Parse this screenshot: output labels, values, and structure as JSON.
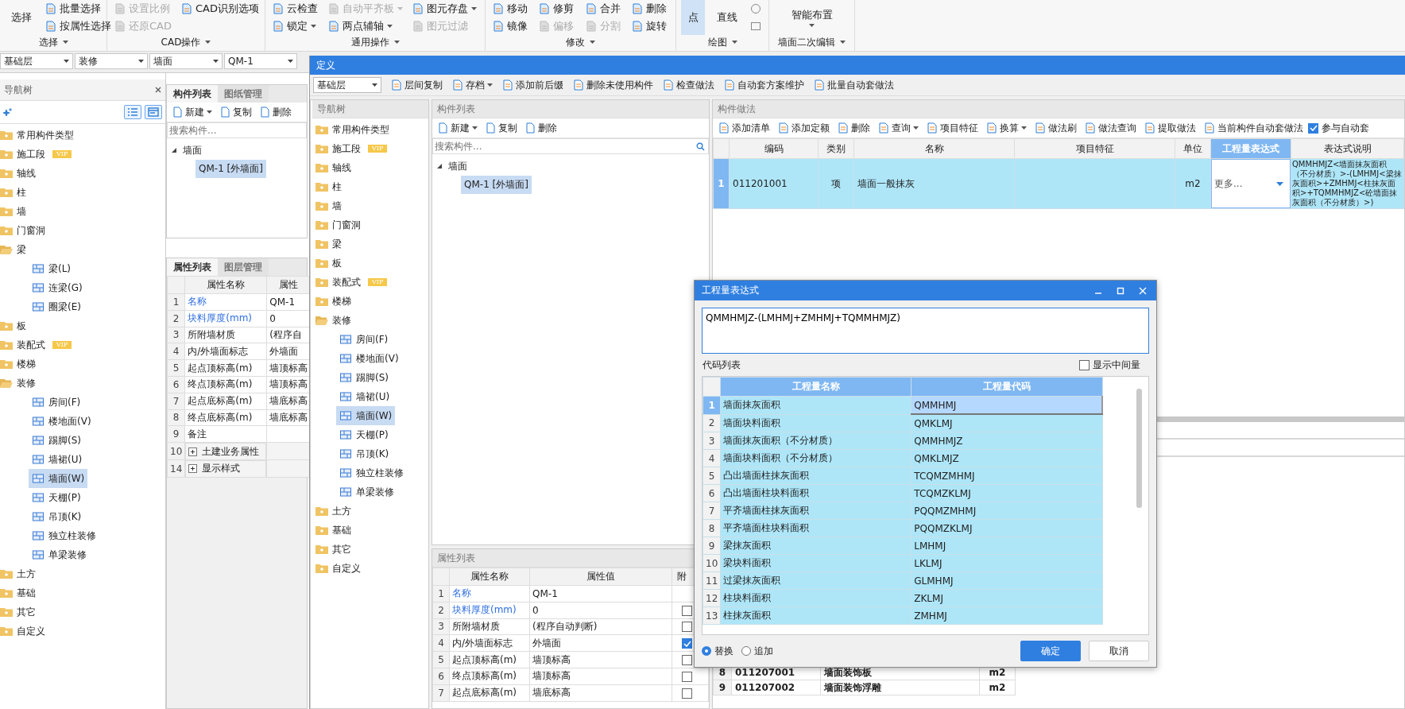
{
  "ribbon": {
    "groups": [
      {
        "label": "选择",
        "items": [
          {
            "kind": "large",
            "label": "选择",
            "dropdown": false,
            "disabled": false
          },
          {
            "kind": "small",
            "label": "批量选择",
            "dropdown": false,
            "disabled": false
          },
          {
            "kind": "small",
            "label": "按属性选择",
            "dropdown": false,
            "disabled": false
          }
        ]
      },
      {
        "label": "CAD操作",
        "items": [
          {
            "kind": "small",
            "label": "设置比例",
            "dropdown": false,
            "disabled": true
          },
          {
            "kind": "small",
            "label": "还原CAD",
            "dropdown": false,
            "disabled": true
          },
          {
            "kind": "small",
            "label": "CAD识别选项",
            "dropdown": false,
            "disabled": false
          }
        ]
      },
      {
        "label": "通用操作",
        "items": [
          {
            "kind": "small",
            "label": "云检查",
            "dropdown": false,
            "disabled": false
          },
          {
            "kind": "small",
            "label": "锁定",
            "dropdown": true,
            "disabled": false
          },
          {
            "kind": "small",
            "label": "自动平齐板",
            "dropdown": true,
            "disabled": true
          },
          {
            "kind": "small",
            "label": "两点辅轴",
            "dropdown": true,
            "disabled": false
          },
          {
            "kind": "small",
            "label": "图元存盘",
            "dropdown": true,
            "disabled": false
          },
          {
            "kind": "small",
            "label": "图元过滤",
            "dropdown": false,
            "disabled": true
          }
        ]
      },
      {
        "label": "修改",
        "items": [
          {
            "kind": "small",
            "label": "移动",
            "dropdown": false,
            "disabled": false
          },
          {
            "kind": "small",
            "label": "镜像",
            "dropdown": false,
            "disabled": false
          },
          {
            "kind": "small",
            "label": "修剪",
            "dropdown": false,
            "disabled": false
          },
          {
            "kind": "small",
            "label": "偏移",
            "dropdown": false,
            "disabled": true
          },
          {
            "kind": "small",
            "label": "合并",
            "dropdown": false,
            "disabled": false
          },
          {
            "kind": "small",
            "label": "分割",
            "dropdown": false,
            "disabled": true
          },
          {
            "kind": "small",
            "label": "删除",
            "dropdown": false,
            "disabled": false
          },
          {
            "kind": "small",
            "label": "旋转",
            "dropdown": false,
            "disabled": false
          }
        ]
      },
      {
        "label": "绘图",
        "items": [
          {
            "kind": "large",
            "label": "点",
            "selected": true,
            "dropdown": false,
            "disabled": false
          },
          {
            "kind": "large",
            "label": "直线",
            "selected": false,
            "dropdown": false,
            "disabled": false
          },
          {
            "kind": "circle",
            "selected": false
          },
          {
            "kind": "rect",
            "selected": false
          }
        ]
      },
      {
        "label": "墙面二次编辑",
        "items": [
          {
            "kind": "large",
            "label": "智能布置",
            "dropdown": true,
            "disabled": false
          }
        ]
      }
    ]
  },
  "selectors": [
    "基础层",
    "装修",
    "墙面",
    "QM-1"
  ],
  "nav_tree": {
    "title": "导航树",
    "items": [
      {
        "label": "常用构件类型",
        "expanded": false
      },
      {
        "label": "施工段",
        "badge": "VIP",
        "expanded": false
      },
      {
        "label": "轴线",
        "expanded": false
      },
      {
        "label": "柱",
        "expanded": false
      },
      {
        "label": "墙",
        "expanded": false
      },
      {
        "label": "门窗洞",
        "expanded": false
      },
      {
        "label": "梁",
        "expanded": true,
        "children": [
          {
            "label": "梁(L)",
            "selected": false
          },
          {
            "label": "连梁(G)",
            "selected": false
          },
          {
            "label": "圈梁(E)",
            "selected": false
          }
        ]
      },
      {
        "label": "板",
        "expanded": false
      },
      {
        "label": "装配式",
        "badge": "VIP",
        "expanded": false
      },
      {
        "label": "楼梯",
        "expanded": false
      },
      {
        "label": "装修",
        "expanded": true,
        "children": [
          {
            "label": "房间(F)",
            "selected": false
          },
          {
            "label": "楼地面(V)",
            "selected": false
          },
          {
            "label": "踢脚(S)",
            "selected": false
          },
          {
            "label": "墙裙(U)",
            "selected": false
          },
          {
            "label": "墙面(W)",
            "selected": true
          },
          {
            "label": "天棚(P)",
            "selected": false
          },
          {
            "label": "吊顶(K)",
            "selected": false
          },
          {
            "label": "独立柱装修",
            "selected": false
          },
          {
            "label": "单梁装修",
            "selected": false
          }
        ]
      },
      {
        "label": "土方",
        "expanded": false
      },
      {
        "label": "基础",
        "expanded": false
      },
      {
        "label": "其它",
        "expanded": false
      },
      {
        "label": "自定义",
        "expanded": false
      }
    ]
  },
  "component_panel": {
    "tabs": [
      {
        "label": "构件列表",
        "selected": true
      },
      {
        "label": "图纸管理",
        "selected": false
      }
    ],
    "toolbar": [
      {
        "label": "新建",
        "dropdown": true
      },
      {
        "label": "复制",
        "dropdown": false
      },
      {
        "label": "删除",
        "dropdown": false
      }
    ],
    "search": {
      "placeholder": "搜索构件..."
    },
    "tree": [
      {
        "label": "墙面",
        "expanded": true,
        "children": [
          {
            "label": "QM-1 [外墙面]",
            "selected": true
          }
        ]
      }
    ]
  },
  "property_panel": {
    "tabs": [
      {
        "label": "属性列表",
        "selected": true
      },
      {
        "label": "图层管理",
        "selected": false
      }
    ],
    "columns": [
      "属性名称",
      "属性"
    ],
    "rows": [
      {
        "num": "1",
        "name": "名称",
        "value": "QM-1",
        "emphasized": true,
        "kind": "field"
      },
      {
        "num": "2",
        "name": "块料厚度(mm)",
        "value": "0",
        "emphasized": true,
        "kind": "field"
      },
      {
        "num": "3",
        "name": "所附墙材质",
        "value": "(程序自",
        "emphasized": false,
        "kind": "field"
      },
      {
        "num": "4",
        "name": "内/外墙面标志",
        "value": "外墙面",
        "emphasized": false,
        "kind": "field"
      },
      {
        "num": "5",
        "name": "起点顶标高(m)",
        "value": "墙顶标高",
        "emphasized": false,
        "kind": "field"
      },
      {
        "num": "6",
        "name": "终点顶标高(m)",
        "value": "墙顶标高",
        "emphasized": false,
        "kind": "field"
      },
      {
        "num": "7",
        "name": "起点底标高(m)",
        "value": "墙底标高",
        "emphasized": false,
        "kind": "field"
      },
      {
        "num": "8",
        "name": "终点底标高(m)",
        "value": "墙底标高",
        "emphasized": false,
        "kind": "field"
      },
      {
        "num": "9",
        "name": "备注",
        "emphasized": false,
        "kind": "field"
      },
      {
        "num": "10",
        "name": "土建业务属性",
        "emphasized": false,
        "kind": "group"
      },
      {
        "num": "14",
        "name": "显示样式",
        "emphasized": false,
        "kind": "group"
      }
    ]
  },
  "definition": {
    "title": "定义",
    "floor": "基础层",
    "toolbar": [
      {
        "label": "层间复制",
        "dropdown": false
      },
      {
        "label": "存档",
        "dropdown": true
      },
      {
        "label": "添加前后缀",
        "dropdown": false
      },
      {
        "label": "删除未使用构件",
        "dropdown": false
      },
      {
        "label": "检查做法",
        "dropdown": false
      },
      {
        "label": "自动套方案维护",
        "dropdown": false
      },
      {
        "label": "批量自动套做法",
        "dropdown": false
      }
    ],
    "nav_tree": {
      "title": "导航树",
      "items": [
        {
          "label": "常用构件类型",
          "expanded": false
        },
        {
          "label": "施工段",
          "badge": "VIP",
          "expanded": false
        },
        {
          "label": "轴线",
          "expanded": false
        },
        {
          "label": "柱",
          "expanded": false
        },
        {
          "label": "墙",
          "expanded": false
        },
        {
          "label": "门窗洞",
          "expanded": false
        },
        {
          "label": "梁",
          "expanded": false
        },
        {
          "label": "板",
          "expanded": false
        },
        {
          "label": "装配式",
          "badge": "VIP",
          "expanded": false
        },
        {
          "label": "楼梯",
          "expanded": false
        },
        {
          "label": "装修",
          "expanded": true,
          "children": [
            {
              "label": "房间(F)",
              "selected": false
            },
            {
              "label": "楼地面(V)",
              "selected": false
            },
            {
              "label": "踢脚(S)",
              "selected": false
            },
            {
              "label": "墙裙(U)",
              "selected": false
            },
            {
              "label": "墙面(W)",
              "selected": true
            },
            {
              "label": "天棚(P)",
              "selected": false
            },
            {
              "label": "吊顶(K)",
              "selected": false
            },
            {
              "label": "独立柱装修",
              "selected": false
            },
            {
              "label": "单梁装修",
              "selected": false
            }
          ]
        },
        {
          "label": "土方",
          "expanded": false
        },
        {
          "label": "基础",
          "expanded": false
        },
        {
          "label": "其它",
          "expanded": false
        },
        {
          "label": "自定义",
          "expanded": false
        }
      ]
    },
    "component_list": {
      "title": "构件列表",
      "toolbar": [
        {
          "label": "新建",
          "dropdown": true
        },
        {
          "label": "复制",
          "dropdown": false
        },
        {
          "label": "删除",
          "dropdown": false
        }
      ],
      "search": {
        "placeholder": "搜索构件..."
      },
      "tree": [
        {
          "label": "墙面",
          "expanded": true,
          "children": [
            {
              "label": "QM-1 [外墙面]",
              "selected": true
            }
          ]
        }
      ]
    },
    "properties": {
      "title": "属性列表",
      "columns": [
        "属性名称",
        "属性值",
        "附"
      ],
      "rows": [
        {
          "num": "1",
          "name": "名称",
          "value": "QM-1",
          "emphasized": true
        },
        {
          "num": "2",
          "name": "块料厚度(mm)",
          "value": "0",
          "emphasized": true,
          "checked": false
        },
        {
          "num": "3",
          "name": "所附墙材质",
          "value": "(程序自动判断)",
          "emphasized": false,
          "checked": false
        },
        {
          "num": "4",
          "name": "内/外墙面标志",
          "value": "外墙面",
          "emphasized": false,
          "checked": true
        },
        {
          "num": "5",
          "name": "起点顶标高(m)",
          "value": "墙顶标高",
          "emphasized": false,
          "checked": false
        },
        {
          "num": "6",
          "name": "终点顶标高(m)",
          "value": "墙顶标高",
          "emphasized": false,
          "checked": false
        },
        {
          "num": "7",
          "name": "起点底标高(m)",
          "value": "墙底标高",
          "emphasized": false,
          "checked": false
        }
      ]
    },
    "method_panel": {
      "title": "构件做法",
      "toolbar": [
        {
          "label": "添加清单",
          "dropdown": false
        },
        {
          "label": "添加定额",
          "dropdown": false
        },
        {
          "label": "删除",
          "dropdown": false
        },
        {
          "label": "查询",
          "dropdown": true
        },
        {
          "label": "项目特征",
          "dropdown": false
        },
        {
          "label": "换算",
          "dropdown": true
        },
        {
          "label": "做法刷",
          "dropdown": false
        },
        {
          "label": "做法查询",
          "dropdown": false
        },
        {
          "label": "提取做法",
          "dropdown": false
        },
        {
          "label": "当前构件自动套做法",
          "dropdown": false
        }
      ],
      "auto_apply": {
        "label": "参与自动套",
        "checked": true
      },
      "columns": [
        {
          "label": "编码",
          "selected": false
        },
        {
          "label": "类别",
          "selected": false
        },
        {
          "label": "名称",
          "selected": false
        },
        {
          "label": "项目特征",
          "selected": false
        },
        {
          "label": "单位",
          "selected": false
        },
        {
          "label": "工程量表达式",
          "selected": true
        },
        {
          "label": "表达式说明",
          "selected": false
        }
      ],
      "rows": [
        {
          "num": "1",
          "code": "011201001",
          "type": "项",
          "name": "墙面一般抹灰",
          "unit": "m2",
          "expression": "更多...",
          "description": "QMMHMJZ<墙面抹灰面积（不分材质）>-(LMHMJ<梁抹灰面积>+ZMHMJ<柱抹灰面积>+TQMMHMJZ<砼墙面抹灰面积（不分材质）>)",
          "selected": true
        }
      ],
      "lower_rows": [
        {
          "num": "8",
          "code": "011207001",
          "name": "墙面装饰板",
          "unit": "m2"
        },
        {
          "num": "9",
          "code": "011207002",
          "name": "墙面装饰浮雕",
          "unit": "m2"
        }
      ]
    }
  },
  "dialog": {
    "title": "工程量表达式",
    "expression": "QMMHMJZ-(LMHMJ+ZMHMJ+TQMMHMJZ)",
    "list_label": "代码列表",
    "show_intermediate": {
      "label": "显示中间量",
      "checked": false
    },
    "columns": [
      "工程量名称",
      "工程量代码"
    ],
    "rows": [
      {
        "num": "1",
        "name": "墙面抹灰面积",
        "code": "QMMHMJ",
        "selected": true
      },
      {
        "num": "2",
        "name": "墙面块料面积",
        "code": "QMKLMJ",
        "selected": false
      },
      {
        "num": "3",
        "name": "墙面抹灰面积（不分材质）",
        "code": "QMMHMJZ",
        "selected": false
      },
      {
        "num": "4",
        "name": "墙面块料面积（不分材质）",
        "code": "QMKLMJZ",
        "selected": false
      },
      {
        "num": "5",
        "name": "凸出墙面柱抹灰面积",
        "code": "TCQMZMHMJ",
        "selected": false
      },
      {
        "num": "6",
        "name": "凸出墙面柱块料面积",
        "code": "TCQMZKLMJ",
        "selected": false
      },
      {
        "num": "7",
        "name": "平齐墙面柱抹灰面积",
        "code": "PQQMZMHMJ",
        "selected": false
      },
      {
        "num": "8",
        "name": "平齐墙面柱块料面积",
        "code": "PQQMZKLMJ",
        "selected": false
      },
      {
        "num": "9",
        "name": "梁抹灰面积",
        "code": "LMHMJ",
        "selected": false
      },
      {
        "num": "10",
        "name": "梁块料面积",
        "code": "LKLMJ",
        "selected": false
      },
      {
        "num": "11",
        "name": "过梁抹灰面积",
        "code": "GLMHMJ",
        "selected": false
      },
      {
        "num": "12",
        "name": "柱块料面积",
        "code": "ZKLMJ",
        "selected": false
      },
      {
        "num": "13",
        "name": "柱抹灰面积",
        "code": "ZMHMJ",
        "selected": false
      }
    ],
    "modes": [
      {
        "label": "替换",
        "selected": true
      },
      {
        "label": "追加",
        "selected": false
      }
    ],
    "buttons": [
      {
        "label": "确定",
        "kind": "primary"
      },
      {
        "label": "取消",
        "kind": "secondary"
      }
    ]
  }
}
